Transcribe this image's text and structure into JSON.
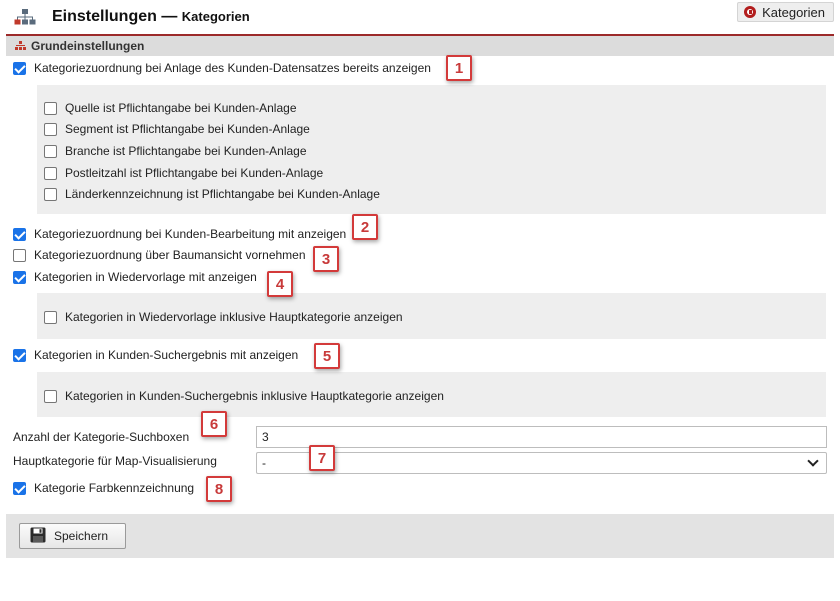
{
  "header": {
    "title": "Einstellungen",
    "separator": " — ",
    "subtitle": "Kategorien",
    "button_label": "Kategorien"
  },
  "section": {
    "title": "Grundeinstellungen"
  },
  "options": {
    "kategoriezuordnung_anlage": {
      "label": "Kategoriezuordnung bei Anlage des Kunden-Datensatzes bereits anzeigen",
      "checked": true
    },
    "quelle_pflicht": {
      "label": "Quelle ist Pflichtangabe bei Kunden-Anlage",
      "checked": false
    },
    "segment_pflicht": {
      "label": "Segment ist Pflichtangabe bei Kunden-Anlage",
      "checked": false
    },
    "branche_pflicht": {
      "label": "Branche ist Pflichtangabe bei Kunden-Anlage",
      "checked": false
    },
    "plz_pflicht": {
      "label": "Postleitzahl ist Pflichtangabe bei Kunden-Anlage",
      "checked": false
    },
    "laender_pflicht": {
      "label": "Länderkennzeichnung ist Pflichtangabe bei Kunden-Anlage",
      "checked": false
    },
    "kunden_bearbeitung": {
      "label": "Kategoriezuordnung bei Kunden-Bearbeitung mit anzeigen",
      "checked": true
    },
    "baumansicht": {
      "label": "Kategoriezuordnung über Baumansicht vornehmen",
      "checked": false
    },
    "wiedervorlage": {
      "label": "Kategorien in Wiedervorlage mit anzeigen",
      "checked": true
    },
    "wiedervorlage_haupt": {
      "label": "Kategorien in Wiedervorlage inklusive Hauptkategorie anzeigen",
      "checked": false
    },
    "suchergebnis": {
      "label": "Kategorien in Kunden-Suchergebnis mit anzeigen",
      "checked": true
    },
    "suchergebnis_haupt": {
      "label": "Kategorien in Kunden-Suchergebnis inklusive Hauptkategorie anzeigen",
      "checked": false
    },
    "farbkennzeichnung": {
      "label": "Kategorie Farbkennzeichnung",
      "checked": true
    }
  },
  "fields": {
    "suchboxen": {
      "label": "Anzahl der Kategorie-Suchboxen",
      "value": "3"
    },
    "map_visualisierung": {
      "label": "Hauptkategorie für Map-Visualisierung",
      "selected": "-"
    }
  },
  "footer": {
    "save_label": "Speichern"
  },
  "callouts": [
    "1",
    "2",
    "3",
    "4",
    "5",
    "6",
    "7",
    "8"
  ],
  "colors": {
    "accent_red": "#9c2a2a",
    "checkbox_blue": "#1a73e8",
    "callout_red": "#d33a3a",
    "panel_gray": "#eeeeee"
  },
  "icons": {
    "header": "sitemap-icon",
    "header_button": "back-circle-icon",
    "section": "sitemap-small-icon",
    "save": "floppy-disk-icon",
    "select": "chevron-down-icon"
  }
}
